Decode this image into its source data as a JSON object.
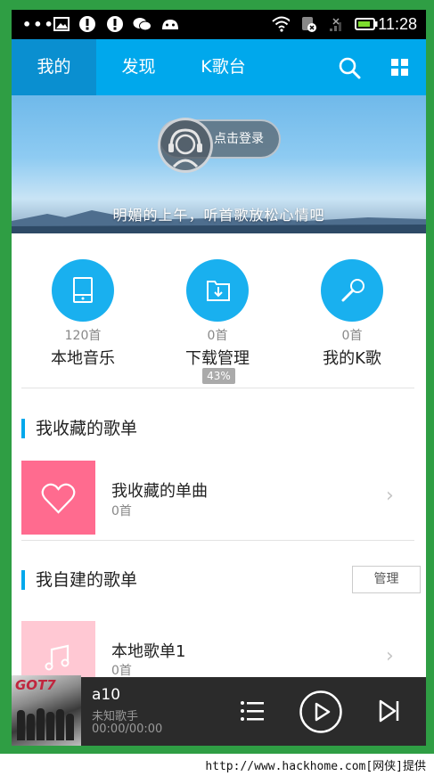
{
  "status_bar": {
    "time": "11:28",
    "icons": [
      "more-dots-icon",
      "image-icon",
      "alert-icon",
      "alert-icon",
      "wechat-icon",
      "android-icon",
      "wifi-icon",
      "data-icon",
      "signal-icon",
      "battery-icon"
    ]
  },
  "tabs": [
    {
      "label": "我的",
      "active": true
    },
    {
      "label": "发现",
      "active": false
    },
    {
      "label": "K歌台",
      "active": false
    }
  ],
  "banner": {
    "login_label": "点击登录",
    "caption": "明媚的上午，听首歌放松心情吧"
  },
  "quick": [
    {
      "count": "120首",
      "label": "本地音乐",
      "icon": "phone-icon"
    },
    {
      "count": "0首",
      "label": "下载管理",
      "icon": "download-folder-icon"
    },
    {
      "count": "0首",
      "label": "我的K歌",
      "icon": "microphone-icon"
    }
  ],
  "download_progress": "43%",
  "favorites": {
    "title": "我收藏的歌单",
    "item": {
      "title": "我收藏的单曲",
      "count": "0首"
    }
  },
  "created": {
    "title": "我自建的歌单",
    "manage_label": "管理",
    "item": {
      "title": "本地歌单1",
      "count": "0首"
    }
  },
  "player": {
    "album_brand": "GOT7",
    "song": "a10",
    "artist": "未知歌手",
    "time": "00:00/00:00"
  },
  "footer": "http://www.hackhome.com[网侠]提供",
  "colors": {
    "accent": "#00a8ec",
    "accent_dark": "#0a8fd0",
    "favorite_pink": "#ff6b8f",
    "player_bg": "#2b2b2b"
  }
}
